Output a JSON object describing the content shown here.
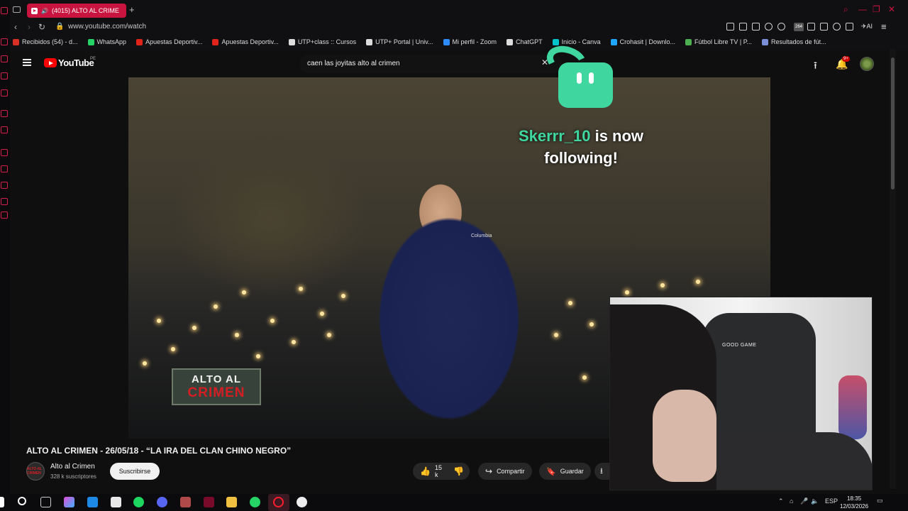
{
  "browser": {
    "tab_title": "(4015) ALTO AL CRIME",
    "url": "www.youtube.com/watch",
    "bookmarks": [
      {
        "label": "Recibidos (54) - d...",
        "color": "#d93025"
      },
      {
        "label": "WhatsApp",
        "color": "#25d366"
      },
      {
        "label": "Apuestas Deportiv...",
        "color": "#e2231a"
      },
      {
        "label": "Apuestas Deportiv...",
        "color": "#e2231a"
      },
      {
        "label": "UTP+class :: Cursos",
        "color": "#dddddd"
      },
      {
        "label": "UTP+ Portal | Univ...",
        "color": "#dddddd"
      },
      {
        "label": "Mi perfil - Zoom",
        "color": "#2d8cff"
      },
      {
        "label": "ChatGPT",
        "color": "#dddddd"
      },
      {
        "label": "Inicio - Canva",
        "color": "#00c4cc"
      },
      {
        "label": "Crohasit | Downlo...",
        "color": "#1ea7fd"
      },
      {
        "label": "Fútbol Libre TV | P...",
        "color": "#4caf50"
      },
      {
        "label": "Resultados de fút...",
        "color": "#7b8fd8"
      }
    ],
    "extension_badge": "264",
    "ai_label": "AI"
  },
  "youtube": {
    "logo_text": "YouTube",
    "country_code": "PE",
    "search_value": "caen las joyitas alto al crimen",
    "notification_count": "9+",
    "video": {
      "title": "ALTO AL CRIMEN - 26/05/18 - “LA IRA DEL CLAN CHINO NEGRO”",
      "brand_line1": "ALTO AL",
      "brand_line2": "CRIMEN",
      "jacket_label": "Columbia"
    },
    "channel": {
      "name": "Alto al Crimen",
      "subscribers": "328 k suscriptores",
      "avatar_text": "ALTO AL CRIMEN",
      "subscribe_label": "Suscribirse"
    },
    "actions": {
      "likes": "15 k",
      "share_label": "Compartir",
      "save_label": "Guardar"
    }
  },
  "overlay": {
    "username": "Skerrr_10",
    "line1_rest": " is now",
    "line2": "following!",
    "accent": "#3fd6a0"
  },
  "webcam": {
    "chair_brand": "GOOD GAME"
  },
  "taskbar": {
    "language": "ESP",
    "time": "18:35",
    "date": "12/03/2026"
  }
}
